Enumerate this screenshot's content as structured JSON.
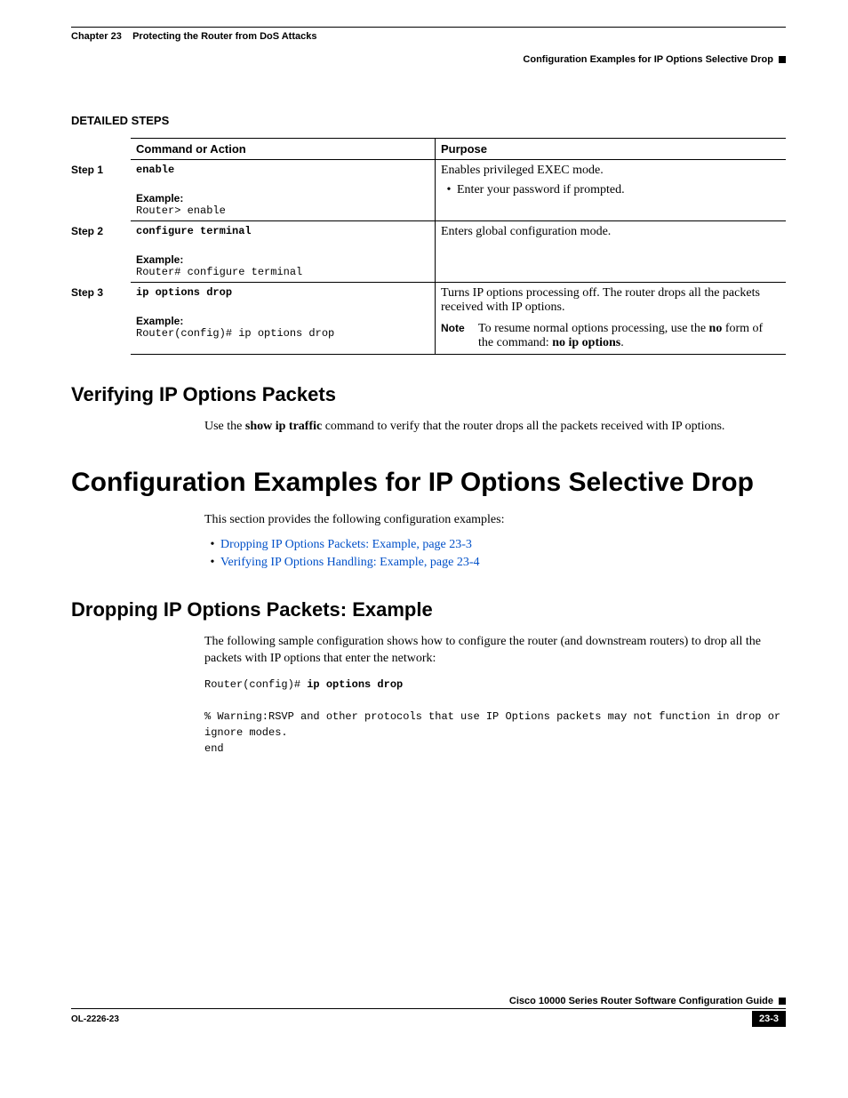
{
  "header": {
    "chapter_left": "Chapter 23    Protecting the Router from DoS Attacks",
    "chapter_right": "Configuration Examples for IP Options Selective Drop"
  },
  "detailed_steps_title": "DETAILED STEPS",
  "table": {
    "col1": "Command or Action",
    "col2": "Purpose",
    "steps": [
      {
        "step": "Step 1",
        "cmd": "enable",
        "ex_label": "Example:",
        "ex": "Router> enable",
        "purpose1": "Enables privileged EXEC mode.",
        "purpose_bullet": "Enter your password if prompted."
      },
      {
        "step": "Step 2",
        "cmd": "configure terminal",
        "ex_label": "Example:",
        "ex": "Router# configure terminal",
        "purpose1": "Enters global configuration mode."
      },
      {
        "step": "Step 3",
        "cmd": "ip options drop",
        "ex_label": "Example:",
        "ex": "Router(config)# ip options drop",
        "purpose1": "Turns IP options processing off. The router drops all the packets received with IP options.",
        "note_label": "Note",
        "note_pre": "To resume normal options processing, use the ",
        "note_bold1": "no",
        "note_mid": " form of the command: ",
        "note_bold2": "no ip options",
        "note_post": "."
      }
    ]
  },
  "h2_verify": "Verifying IP Options Packets",
  "verify_para_pre": "Use the ",
  "verify_para_bold": "show ip traffic",
  "verify_para_post": " command to verify that the router drops all the packets received with IP options.",
  "h1_config": "Configuration Examples for IP Options Selective Drop",
  "config_intro": "This section provides the following configuration examples:",
  "links": {
    "l1": "Dropping IP Options Packets: Example, page 23-3",
    "l2": "Verifying IP Options Handling: Example, page 23-4"
  },
  "h2_drop": "Dropping IP Options Packets: Example",
  "drop_para": "The following sample configuration shows how to configure the router (and downstream routers) to drop all the packets with IP options that enter the network:",
  "code": {
    "line1_pre": "Router(config)# ",
    "line1_bold": "ip options drop",
    "line2": "% Warning:RSVP and other protocols that use IP Options packets may not function in drop or ignore modes.",
    "line3": "end"
  },
  "footer": {
    "guide": "Cisco 10000 Series Router Software Configuration Guide",
    "docid": "OL-2226-23",
    "pagenum": "23-3"
  }
}
